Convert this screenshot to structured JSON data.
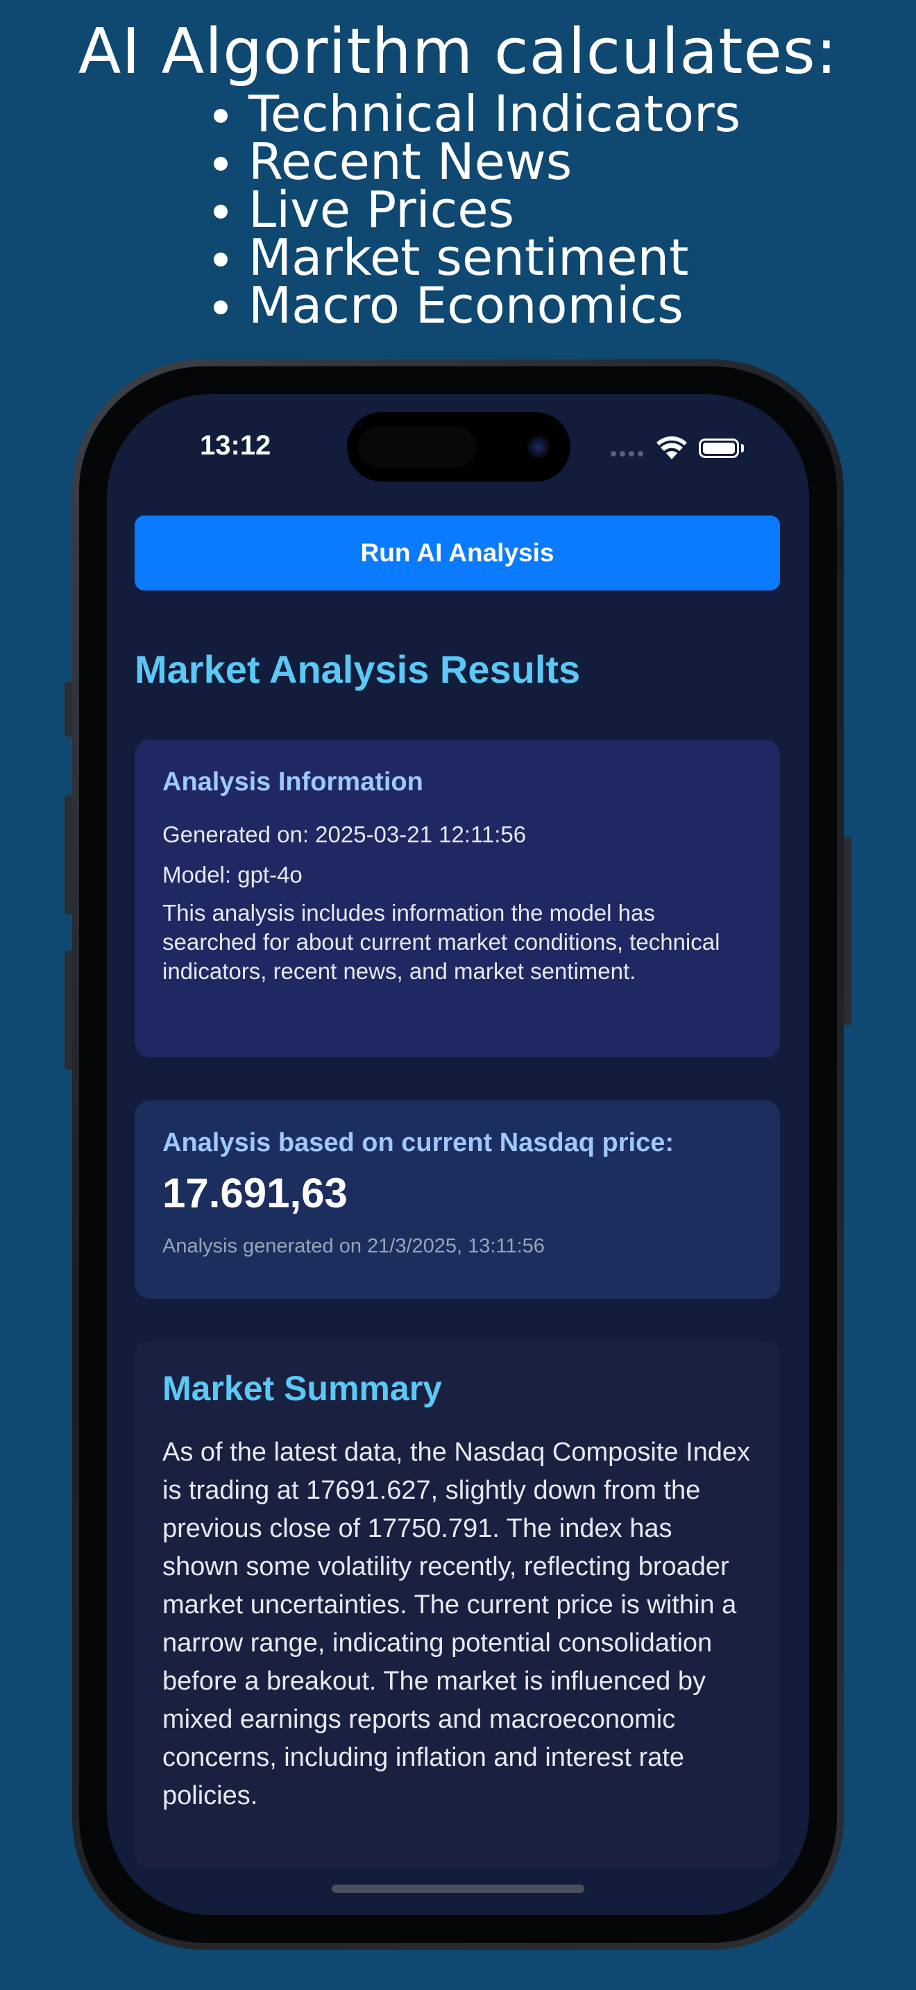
{
  "promo": {
    "headline": "AI Algorithm calculates:",
    "features": [
      "Technical Indicators",
      "Recent News",
      "Live Prices",
      "Market sentiment",
      "Macro Economics"
    ]
  },
  "status_bar": {
    "time": "13:12"
  },
  "app": {
    "run_button_label": "Run AI Analysis",
    "results_title": "Market Analysis Results",
    "analysis_info": {
      "heading": "Analysis Information",
      "generated_on": "Generated on: 2025-03-21 12:11:56",
      "model": "Model: gpt-4o",
      "description": "This analysis includes information the model has searched for about current market conditions, technical indicators, recent news, and market sentiment."
    },
    "price_card": {
      "heading": "Analysis based on current Nasdaq price:",
      "price": "17.691,63",
      "note": "Analysis generated on 21/3/2025, 13:11:56"
    },
    "market_summary": {
      "heading": "Market Summary",
      "body": "As of the latest data, the Nasdaq Composite Index is trading at 17691.627, slightly down from the previous close of 17750.791. The index has shown some volatility recently, reflecting broader market uncertainties. The current price is within a narrow range, indicating potential consolidation before a breakout. The market is influenced by mixed earnings reports and macroeconomic concerns, including inflation and interest rate policies."
    }
  },
  "colors": {
    "page_background": "#0f4870",
    "screen_background": "#111d3b",
    "accent_button": "#0a7bff",
    "title_cyan": "#5bc8f5",
    "card_heading": "#9fc8ff"
  },
  "icons": {
    "signal": "cellular-signal-icon",
    "wifi": "wifi-icon",
    "battery": "battery-icon"
  }
}
